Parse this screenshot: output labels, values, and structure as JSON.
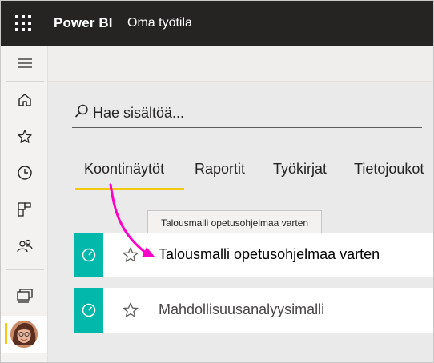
{
  "header": {
    "brand": "Power BI",
    "workspace": "Oma työtila"
  },
  "search": {
    "placeholder": "Hae sisältöä..."
  },
  "tabs": [
    {
      "label": "Koontinäytöt",
      "active": true
    },
    {
      "label": "Raportit",
      "active": false
    },
    {
      "label": "Työkirjat",
      "active": false
    },
    {
      "label": "Tietojoukot",
      "active": false
    }
  ],
  "tooltip": "Talousmalli opetusohjelmaa varten",
  "items": [
    {
      "name": "Talousmalli opetusohjelmaa varten",
      "icon": "dashboard-icon"
    },
    {
      "name": "Mahdollisuusanalyysimalli",
      "icon": "dashboard-icon"
    }
  ],
  "colors": {
    "topbar": "#252423",
    "accent_yellow": "#f2c811",
    "dashboard_teal": "#01b8aa",
    "annotation_arrow": "#ff00c8"
  }
}
